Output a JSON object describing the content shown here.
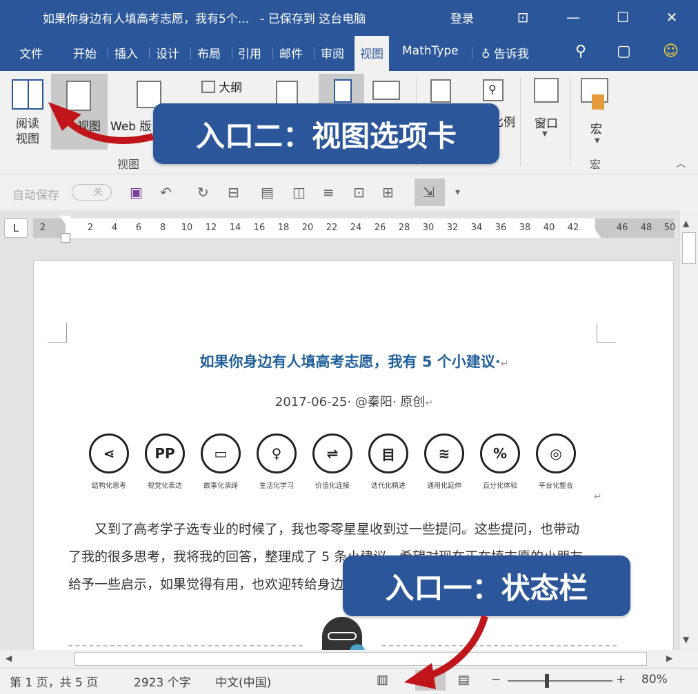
{
  "window": {
    "title": "如果你身边有人填高考志愿，我有5个...",
    "save_status": "- 已保存到 这台电脑",
    "login": "登录"
  },
  "tabs": [
    "文件",
    "开始",
    "插入",
    "设计",
    "布局",
    "引用",
    "邮件",
    "审阅",
    "视图",
    "MathType"
  ],
  "active_tab": "视图",
  "tell_me": "告诉我",
  "ribbon": {
    "read_view": "阅读\n视图",
    "print_view_partial": "视图",
    "web_view_partial": "Web 版",
    "outline": "大纲",
    "zoom_partial": "比例",
    "window": "窗口",
    "macro": "宏",
    "group_view": "视图",
    "group_macro": "宏"
  },
  "qat": {
    "autosave": "自动保存",
    "autosave_state": "关"
  },
  "ruler": {
    "corner": "L",
    "ticks": [
      "2",
      "2",
      "4",
      "6",
      "8",
      "10",
      "12",
      "14",
      "16",
      "18",
      "20",
      "22",
      "24",
      "26",
      "28",
      "30",
      "32",
      "34",
      "36",
      "38",
      "40",
      "42",
      "46",
      "48",
      "50"
    ]
  },
  "document": {
    "title": "如果你身边有人填高考志愿，我有 5 个小建议·",
    "meta": "2017-06-25· @秦阳· 原创",
    "icons": [
      {
        "label": "结构化思考",
        "glyph": "⋖"
      },
      {
        "label": "视觉化表达",
        "glyph": "PP"
      },
      {
        "label": "故事化演绎",
        "glyph": "▭"
      },
      {
        "label": "生活化学习",
        "glyph": "♀"
      },
      {
        "label": "价值化连接",
        "glyph": "⇌"
      },
      {
        "label": "迭代化精进",
        "glyph": "目"
      },
      {
        "label": "通用化延伸",
        "glyph": "≋"
      },
      {
        "label": "百分化体验",
        "glyph": "%"
      },
      {
        "label": "平台化整合",
        "glyph": "◎"
      }
    ],
    "paragraph_lines": [
      "又到了高考学子选专业的时候了，我也零零星星收到过一些提问。这些提问，也带动",
      "了我的很多思考，我将我的回答，整理成了 5 条小建议，希望对现在正在填志愿的小朋友",
      "给予一些启示，如果觉得有用，也欢迎转给身边"
    ]
  },
  "status": {
    "page": "第 1 页，共 5 页",
    "words": "2923 个字",
    "language": "中文(中国)",
    "zoom": "80%"
  },
  "callouts": {
    "entry_two": "入口二：视图选项卡",
    "entry_one": "入口一：状态栏"
  },
  "colors": {
    "word_blue": "#2b579a",
    "arrow_red": "#c0161b",
    "doc_title": "#1f5f99"
  }
}
